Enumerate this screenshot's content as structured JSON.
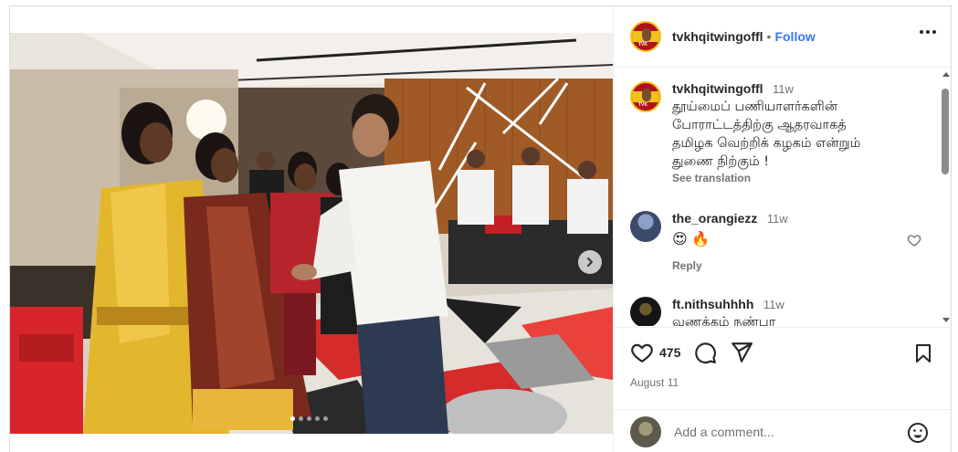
{
  "post": {
    "username": "tvkhqitwingoffl",
    "separator": "•",
    "follow_label": "Follow",
    "avatar_text": "TVK",
    "caption": {
      "username": "tvkhqitwingoffl",
      "time": "11w",
      "lines": [
        "தூய்மைப் பணியாளர்களின்",
        "போராட்டத்திற்கு ஆதரவாகத்",
        "தமிழக வெற்றிக் கழகம் என்றும்",
        "துணை நிற்கும் !"
      ],
      "see_translation": "See translation"
    },
    "comments": [
      {
        "username": "the_orangiezz",
        "time": "11w",
        "text": "😍 🔥",
        "reply": "Reply"
      },
      {
        "username": "ft.nithsuhhhh",
        "time": "11w",
        "text": "வணக்கம் நண்பா"
      }
    ],
    "likes": "475",
    "date": "August 11",
    "add_comment_placeholder": "Add a comment...",
    "carousel": {
      "current": 1,
      "total": 5
    }
  },
  "icons": {
    "more": "more-options-icon",
    "next": "chevron-right-icon",
    "heart": "heart-icon",
    "comment": "comment-icon",
    "share": "share-icon",
    "save": "bookmark-icon",
    "emoji": "emoji-icon"
  },
  "colors": {
    "follow": "#3478f6",
    "text": "#262626",
    "secondary": "#737373",
    "border": "#dbdbdb",
    "avatar_red": "#b3121b",
    "avatar_yellow": "#f1c21b"
  }
}
